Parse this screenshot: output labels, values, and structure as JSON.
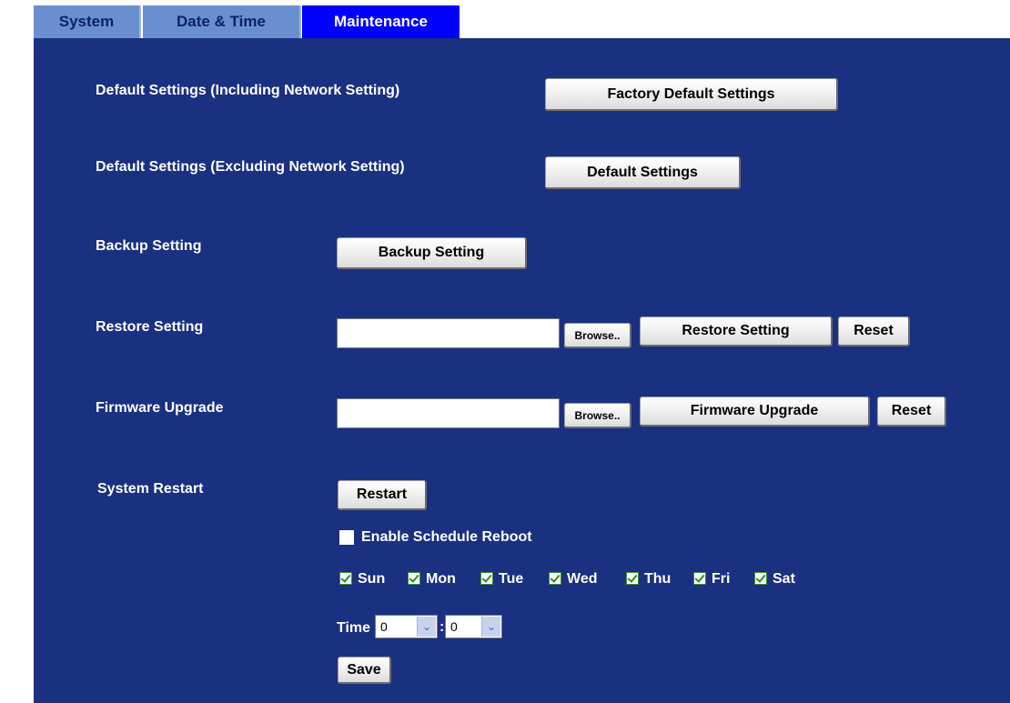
{
  "tabs": [
    {
      "label": "System",
      "active": false
    },
    {
      "label": "Date & Time",
      "active": false
    },
    {
      "label": "Maintenance",
      "active": true
    }
  ],
  "default_incl": {
    "label": "Default Settings (Including Network Setting)",
    "button": "Factory Default Settings"
  },
  "default_excl": {
    "label": "Default Settings (Excluding Network Setting)",
    "button": "Default Settings"
  },
  "backup": {
    "label": "Backup Setting",
    "button": "Backup Setting"
  },
  "restore": {
    "label": "Restore Setting",
    "file_value": "",
    "browse": "Browse..",
    "button": "Restore Setting",
    "reset": "Reset"
  },
  "firmware": {
    "label": "Firmware Upgrade",
    "file_value": "",
    "browse": "Browse..",
    "button": "Firmware Upgrade",
    "reset": "Reset"
  },
  "restart": {
    "label": "System Restart",
    "button": "Restart",
    "schedule_label": "Enable Schedule Reboot",
    "schedule_enabled": false,
    "days": [
      {
        "label": "Sun",
        "checked": true
      },
      {
        "label": "Mon",
        "checked": true
      },
      {
        "label": "Tue",
        "checked": true
      },
      {
        "label": "Wed",
        "checked": true
      },
      {
        "label": "Thu",
        "checked": true
      },
      {
        "label": "Fri",
        "checked": true
      },
      {
        "label": "Sat",
        "checked": true
      }
    ],
    "time_label": "Time",
    "hour": "0",
    "separator": ":",
    "minute": "0",
    "save": "Save"
  },
  "colors": {
    "panel_bg": "#1a3080",
    "tab_active": "#0000ff",
    "tab_inactive": "#6a8fd0"
  }
}
